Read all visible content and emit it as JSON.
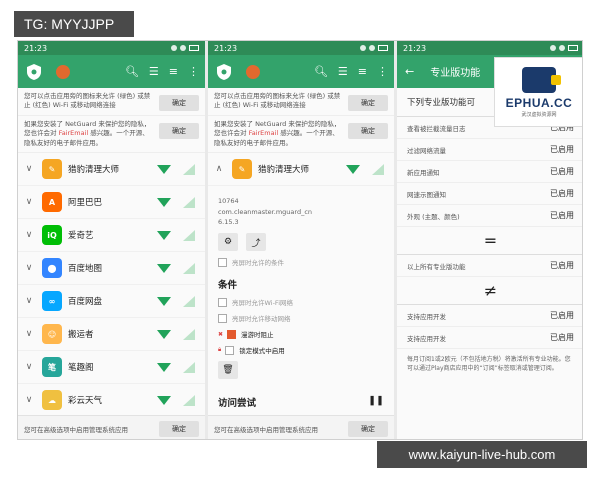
{
  "watermark_top": "TG: MYYJJPP",
  "watermark_bottom": "www.kaiyun-live-hub.com",
  "colors": {
    "statusbar": "#2e8b57",
    "appbar": "#33a36b",
    "wifi": "#21a35a",
    "accent_red": "#e35a2e",
    "logo": "#1b3a6b"
  },
  "status": {
    "time": "21:23"
  },
  "notices": {
    "n1_pre": "您可以点击应用旁的图标来允许 (绿色) 或禁止 (红色) Wi-Fi 或移动网络连接",
    "n2_pre": "如果您安装了 NetGuard 来保护您的隐私，您也许会对 ",
    "n2_link": "FairEmail",
    "n2_post": " 感兴趣。一个开源、隐私友好的电子邮件应用。",
    "ok": "确定",
    "bottom": "您可在高级选项中启用管理系统应用"
  },
  "apps": [
    {
      "name": "猎豹清理大师",
      "color": "#f5a623",
      "glyph": "✎"
    },
    {
      "name": "阿里巴巴",
      "color": "#ff6a00",
      "glyph": "A"
    },
    {
      "name": "爱奇艺",
      "color": "#00be06",
      "glyph": "iQ"
    },
    {
      "name": "百度地图",
      "color": "#3385ff",
      "glyph": "⬤"
    },
    {
      "name": "百度网盘",
      "color": "#06a7ff",
      "glyph": "∞"
    },
    {
      "name": "搬运者",
      "color": "#ffb74d",
      "glyph": "☺"
    },
    {
      "name": "笔趣阁",
      "color": "#26a69a",
      "glyph": "笔"
    },
    {
      "name": "彩云天气",
      "color": "#f0c040",
      "glyph": "☁"
    }
  ],
  "detail": {
    "app_name": "猎豹清理大师",
    "uid": "10764",
    "package": "com.cleanmaster.mguard_cn",
    "version": "6.15.3",
    "disabled_opt": "亮屏时允许的条件",
    "conditions_title": "条件",
    "cond1": "亮屏时允许Wi-Fi网络",
    "cond2": "亮屏时允许移动网络",
    "cond3": "漫游时阻止",
    "cond4": "锁定模式中启用",
    "visit_title": "访问尝试",
    "pause_icon": "❚❚"
  },
  "pro": {
    "title": "专业版功能",
    "head": "下列专业版功能可",
    "features": [
      {
        "label": "查看被拦截流量日志",
        "status": "已启用"
      },
      {
        "label": "过滤网络流量",
        "status": "已启用"
      },
      {
        "label": "新应用通知",
        "status": "已启用"
      },
      {
        "label": "网速示图通知",
        "status": "已启用"
      },
      {
        "label": "外观 (主题、颜色)",
        "status": "已启用"
      }
    ],
    "eq": "=",
    "all_label": "以上所有专业版功能",
    "all_status": "已启用",
    "neq": "≠",
    "support1": "支持应用开发",
    "support1_status": "已启用",
    "support2": "支持应用开发",
    "support2_status": "已启用",
    "footnote": "每月订阅1或2欧元（不包括地方税）将激活所有专业功能。您可以通过Play商店应用中的“订阅”标签取消或管理订阅。"
  },
  "logo": {
    "text": "EPHUA.CC",
    "sub": "武汉虚拟资源网"
  }
}
